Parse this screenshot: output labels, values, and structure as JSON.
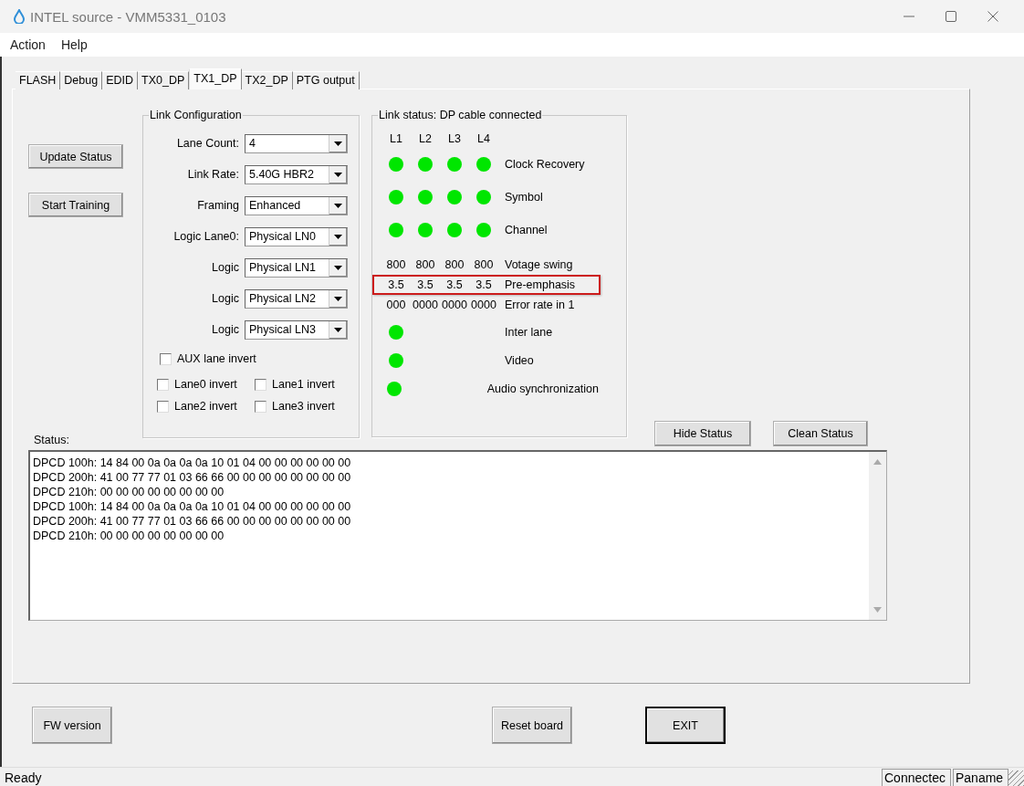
{
  "window": {
    "title": "INTEL source - VMM5331_0103"
  },
  "menu": [
    "Action",
    "Help"
  ],
  "tabs": [
    {
      "label": "FLASH",
      "selected": false
    },
    {
      "label": "Debug",
      "selected": false
    },
    {
      "label": "EDID",
      "selected": false
    },
    {
      "label": "TX0_DP",
      "selected": false
    },
    {
      "label": "TX1_DP",
      "selected": true
    },
    {
      "label": "TX2_DP",
      "selected": false
    },
    {
      "label": "PTG output",
      "selected": false
    }
  ],
  "side_buttons": [
    "Update Status",
    "Start Training"
  ],
  "link_configuration": {
    "title": "Link Configuration",
    "dropdowns": [
      {
        "label": "Lane Count:",
        "value": "4"
      },
      {
        "label": "Link Rate:",
        "value": "5.40G HBR2"
      },
      {
        "label": "Framing",
        "value": "Enhanced"
      },
      {
        "label": "Logic Lane0:",
        "value": "Physical LN0"
      },
      {
        "label": "Logic",
        "value": "Physical LN1"
      },
      {
        "label": "Logic",
        "value": "Physical LN2"
      },
      {
        "label": "Logic",
        "value": "Physical LN3"
      }
    ],
    "aux_checkbox": {
      "label": "AUX lane invert",
      "checked": false
    },
    "lane_checkboxes": [
      {
        "label": "Lane0 invert",
        "checked": false
      },
      {
        "label": "Lane1 invert",
        "checked": false
      },
      {
        "label": "Lane2 invert",
        "checked": false
      },
      {
        "label": "Lane3 invert",
        "checked": false
      }
    ]
  },
  "link_status": {
    "title": "Link status: DP cable connected",
    "lanes": [
      "L1",
      "L2",
      "L3",
      "L4"
    ],
    "rows": [
      {
        "kind": "leds",
        "leds": [
          {
            "on": true
          },
          {
            "on": true
          },
          {
            "on": true
          },
          {
            "on": true
          }
        ],
        "label": "Clock Recovery",
        "highlighted": false
      },
      {
        "kind": "leds",
        "leds": [
          {
            "on": true
          },
          {
            "on": true
          },
          {
            "on": true
          },
          {
            "on": true
          }
        ],
        "label": "Symbol",
        "highlighted": false
      },
      {
        "kind": "leds",
        "leds": [
          {
            "on": true
          },
          {
            "on": true
          },
          {
            "on": true
          },
          {
            "on": true
          }
        ],
        "label": "Channel",
        "highlighted": false
      },
      {
        "kind": "values",
        "values": [
          "800",
          "800",
          "800",
          "800"
        ],
        "label": "Votage swing",
        "highlighted": false
      },
      {
        "kind": "values",
        "values": [
          "3.5",
          "3.5",
          "3.5",
          "3.5"
        ],
        "label": "Pre-emphasis",
        "highlighted": true
      },
      {
        "kind": "values",
        "values": [
          "000",
          "0000",
          "0000",
          "0000"
        ],
        "label": "Error rate in 1",
        "highlighted": false
      },
      {
        "kind": "single",
        "leds": [
          {
            "on": true
          }
        ],
        "label": "Inter lane",
        "highlighted": false
      },
      {
        "kind": "single",
        "leds": [
          {
            "on": true
          }
        ],
        "label": "Video",
        "highlighted": false
      },
      {
        "kind": "single",
        "leds": [
          {
            "on": true
          }
        ],
        "label": "Audio synchronization",
        "highlighted": false
      }
    ]
  },
  "status": {
    "label": "Status:",
    "lines": [
      "DPCD 100h: 14 84 00 0a 0a 0a 0a 10 01 04 00 00 00 00 00 00",
      "DPCD 200h: 41 00 77 77 01 03 66 66 00 00 00 00 00 00 00 00",
      "DPCD 210h: 00 00 00 00 00 00 00 00",
      "DPCD 100h: 14 84 00 0a 0a 0a 0a 10 01 04 00 00 00 00 00 00",
      "DPCD 200h: 41 00 77 77 01 03 66 66 00 00 00 00 00 00 00 00",
      "DPCD 210h: 00 00 00 00 00 00 00 00"
    ]
  },
  "status_buttons": [
    "Hide Status",
    "Clean Status"
  ],
  "bottom_buttons": [
    {
      "label": "FW version",
      "default": false
    },
    {
      "label": "Reset board",
      "default": false
    },
    {
      "label": "EXIT",
      "default": true
    }
  ],
  "status_bar": [
    "Ready",
    "Connectec",
    "Paname"
  ]
}
